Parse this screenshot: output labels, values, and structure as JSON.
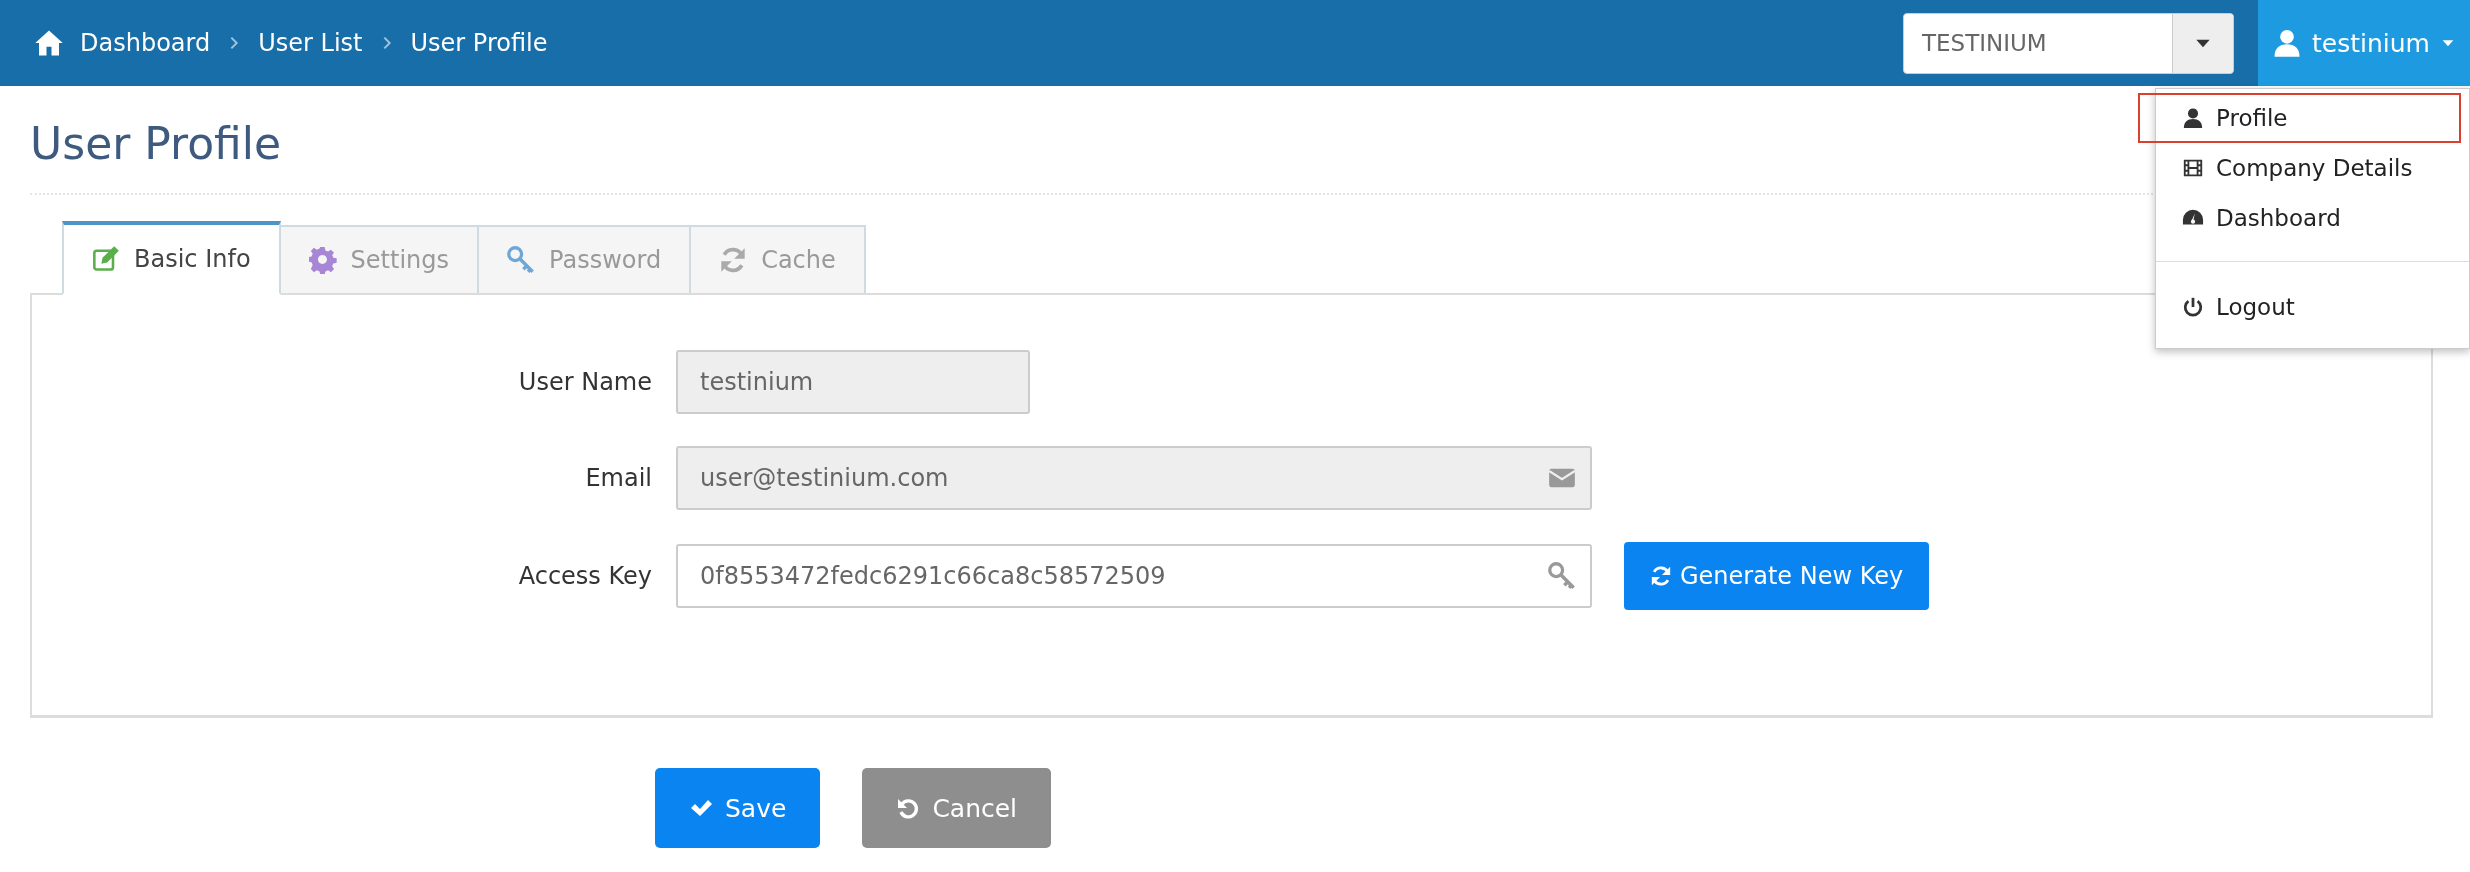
{
  "breadcrumb": [
    {
      "kind": "home",
      "label": "Dashboard"
    },
    {
      "kind": "link",
      "label": "User List"
    },
    {
      "kind": "current",
      "label": "User Profile"
    }
  ],
  "company_select": {
    "value": "TESTINIUM"
  },
  "user_menu": {
    "label": "testinium",
    "expanded": true,
    "items": [
      {
        "kind": "profile",
        "label": "Profile",
        "highlighted": true
      },
      {
        "kind": "company",
        "label": "Company Details",
        "highlighted": false
      },
      {
        "kind": "dashboard",
        "label": "Dashboard",
        "highlighted": false
      },
      {
        "kind": "logout",
        "label": "Logout",
        "highlighted": false
      }
    ]
  },
  "page_title": "User Profile",
  "tabs": [
    {
      "kind": "edit",
      "label": "Basic Info",
      "selected": true
    },
    {
      "kind": "gear",
      "label": "Settings",
      "selected": false
    },
    {
      "kind": "key",
      "label": "Password",
      "selected": false
    },
    {
      "kind": "refresh",
      "label": "Cache",
      "selected": false
    }
  ],
  "form": {
    "fields": [
      {
        "kind": "text",
        "label": "User Name",
        "value": "testinium",
        "disabled": true
      },
      {
        "kind": "email",
        "label": "Email",
        "value": "user@testinium.com",
        "disabled": true
      },
      {
        "kind": "key",
        "label": "Access Key",
        "value": "0f8553472fedc6291c66ca8c58572509",
        "disabled": false
      }
    ],
    "generate_button": {
      "label": "Generate New Key"
    }
  },
  "buttons": [
    {
      "kind": "save",
      "label": "Save"
    },
    {
      "kind": "cancel",
      "label": "Cancel"
    }
  ]
}
